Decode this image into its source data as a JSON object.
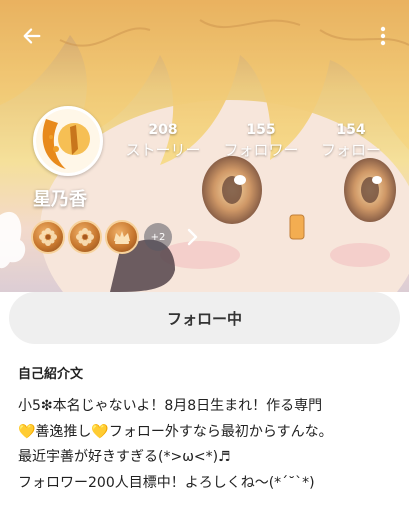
{
  "header": {
    "back_icon": "arrow-left-icon",
    "more_icon": "more-vertical-icon"
  },
  "profile": {
    "username": "星乃香",
    "stats": {
      "stories": {
        "count": "208",
        "label": "ストーリー"
      },
      "followers": {
        "count": "155",
        "label": "フォロワー"
      },
      "following": {
        "count": "154",
        "label": "フォロー"
      }
    },
    "badges": {
      "icons": [
        "flower-badge-icon",
        "flower-badge-icon",
        "crown-badge-icon"
      ],
      "more_count": "+2",
      "chevron_icon": "chevron-right-icon"
    }
  },
  "follow_button": {
    "label": "フォロー中"
  },
  "bio": {
    "title": "自己紹介文",
    "lines": [
      "小5❇本名じゃないよ！8月8日生まれ！作る専門",
      "💛善逸推し💛フォロー外すなら最初からすんな。",
      "最近宇善が好きすぎる(*>ω<*)♬",
      "フォロワー200人目標中！よろしくね〜(*´˘`*)"
    ]
  },
  "colors": {
    "cover_gold": "#e9c36e",
    "badge_bronze": "#c8782f",
    "button_bg": "#efefef",
    "text": "#222222"
  }
}
